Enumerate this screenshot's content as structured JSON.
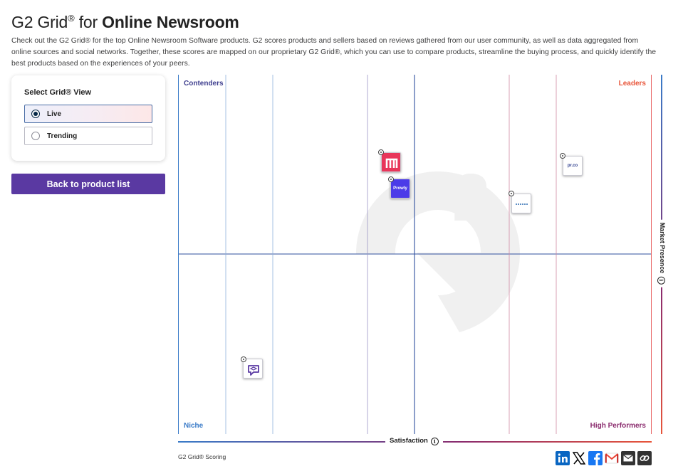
{
  "header": {
    "title_prefix": "G2 Grid",
    "title_reg": "®",
    "title_for": " for ",
    "title_category": "Online Newsroom",
    "description": "Check out the G2 Grid® for the top Online Newsroom Software products. G2 scores products and sellers based on reviews gathered from our user community, as well as data aggregated from online sources and social networks. Together, these scores are mapped on our proprietary G2 Grid®, which you can use to compare products, streamline the buying process, and quickly identify the best products based on the experiences of your peers."
  },
  "view_selector": {
    "title": "Select Grid® View",
    "options": [
      {
        "label": "Live",
        "selected": true
      },
      {
        "label": "Trending",
        "selected": false
      }
    ]
  },
  "back_button": {
    "label": "Back to product list"
  },
  "grid": {
    "quadrants": {
      "contenders": "Contenders",
      "leaders": "Leaders",
      "niche": "Niche",
      "high_performers": "High Performers"
    },
    "y_axis_label": "Market Presence",
    "x_axis_label": "Satisfaction",
    "info_glyph": "i",
    "colors": {
      "contenders": "#3f3f8f",
      "leaders": "#e8553a",
      "niche": "#3a7bc8",
      "high_performers": "#8b2c6e",
      "watermark": "#f2f2f2"
    },
    "products": [
      {
        "logo_text": "m",
        "icon": "m-logo-icon",
        "bg": "#e8365a",
        "fg": "#ffffff"
      },
      {
        "logo_text": "Prowly",
        "icon": "prowly-logo-icon",
        "bg": "#4b3be8",
        "fg": "#ffffff"
      },
      {
        "logo_text": "pr.co",
        "icon": "prco-logo-icon",
        "bg": "#ffffff",
        "fg": "#2a3a8c"
      },
      {
        "logo_text": "",
        "icon": "wordmark-logo-icon",
        "bg": "#ffffff",
        "fg": "#2a6ab0"
      },
      {
        "logo_text": "",
        "icon": "speech-bubble-logo-icon",
        "bg": "#ffffff",
        "fg": "#5a39a2"
      }
    ]
  },
  "footer": {
    "scoring_label": "G2 Grid® Scoring",
    "share": [
      {
        "icon": "linkedin-icon",
        "glyph": "in",
        "color": "#0a66c2"
      },
      {
        "icon": "x-twitter-icon",
        "glyph": "X",
        "color": "#000000"
      },
      {
        "icon": "facebook-icon",
        "glyph": "f",
        "color": "#1877f2"
      },
      {
        "icon": "gmail-icon",
        "glyph": "M",
        "color": "#ea4335"
      },
      {
        "icon": "email-icon",
        "glyph": "✉",
        "color": "#333333"
      },
      {
        "icon": "copy-link-icon",
        "glyph": "🔗",
        "color": "#333333"
      }
    ]
  }
}
